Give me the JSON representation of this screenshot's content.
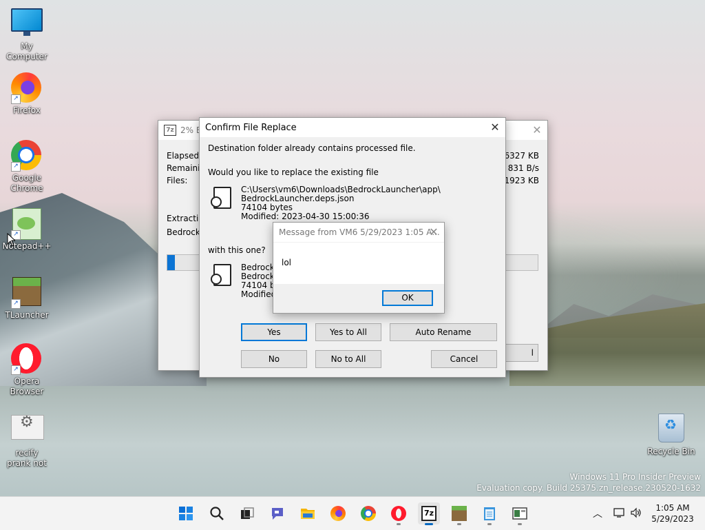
{
  "desktop": {
    "icons": [
      {
        "label": "My Computer"
      },
      {
        "label": "Firefox"
      },
      {
        "label": "Google Chrome"
      },
      {
        "label": "Notepad++"
      },
      {
        "label": "TLauncher"
      },
      {
        "label": "Opera Browser"
      },
      {
        "label": "recify prank not"
      },
      {
        "label": "Recycle Bin"
      }
    ]
  },
  "zip_window": {
    "title": "2% Ex",
    "elapsed_label": "Elapsed tir",
    "remaining_label": "Remaining",
    "files_label": "Files:",
    "size_value": "86327 KB",
    "speed_value": "831 B/s",
    "packed_value": "1923 KB",
    "extracting_label": "Extracting",
    "current_file": "BedrockLa",
    "progress_percent": 2
  },
  "confirm": {
    "title": "Confirm File Replace",
    "msg1": "Destination folder already contains processed file.",
    "msg2": "Would you like to replace the existing file",
    "existing": {
      "path": "C:\\Users\\vm6\\Downloads\\BedrockLauncher\\app\\",
      "name": "BedrockLauncher.deps.json",
      "size": "74104 bytes",
      "modified": "Modified: 2023-04-30 15:00:36"
    },
    "with_label": "with this one?",
    "new": {
      "path": "BedrockL",
      "name": "BedrockL",
      "size": "74104 byt",
      "modified": "Modified:"
    },
    "buttons": {
      "yes": "Yes",
      "yes_all": "Yes to All",
      "auto_rename": "Auto Rename",
      "no": "No",
      "no_all": "No to All",
      "cancel": "Cancel"
    }
  },
  "message": {
    "title": "Message from VM6 5/29/2023 1:05 A...",
    "text": "lol",
    "ok": "OK"
  },
  "watermark": {
    "line1": "Windows 11 Pro Insider Preview",
    "line2": "Evaluation copy. Build 25375.zn_release.230520-1632"
  },
  "taskbar": {
    "time": "1:05 AM",
    "date": "5/29/2023"
  }
}
